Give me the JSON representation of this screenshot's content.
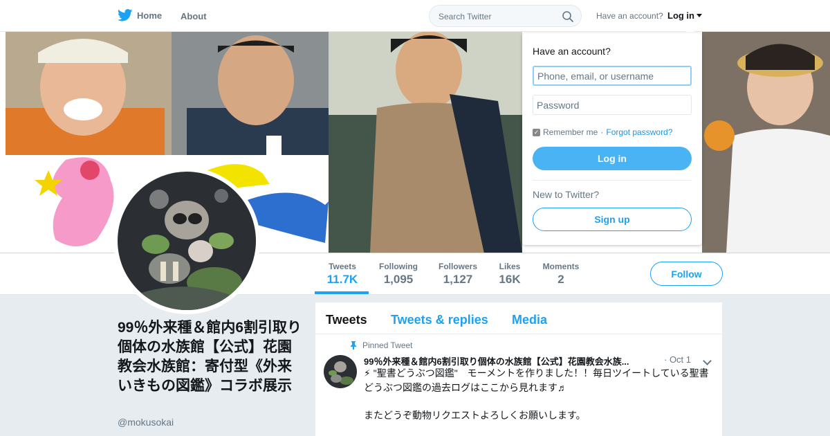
{
  "nav": {
    "home_label": "Home",
    "about_label": "About",
    "search_placeholder": "Search Twitter",
    "have_account": "Have an account?",
    "login_label": "Log in"
  },
  "profile": {
    "name": "99％外来種＆館内6割引取り個体の水族館【公式】花園教会水族館：寄付型《外来いきもの図鑑》コラボ展示",
    "handle": "@mokusokai",
    "follow_label": "Follow",
    "stats": [
      {
        "label": "Tweets",
        "value": "11.7K"
      },
      {
        "label": "Following",
        "value": "1,095"
      },
      {
        "label": "Followers",
        "value": "1,127"
      },
      {
        "label": "Likes",
        "value": "16K"
      },
      {
        "label": "Moments",
        "value": "2"
      }
    ]
  },
  "timeline": {
    "tabs": [
      "Tweets",
      "Tweets & replies",
      "Media"
    ],
    "pinned_label": "Pinned Tweet",
    "tweet": {
      "author": "99％外来種＆館内6割引取り個体の水族館【公式】花園教会水族...",
      "date": "· Oct 1",
      "text_line1": "⚡ \"聖書どうぶつ図鑑\"　モーメントを作りました！！毎日ツイートしている聖書どうぶつ図鑑の過去ログはここから見れます♬",
      "text_line2": "またどうぞ動物リクエストよろしくお願いします。"
    }
  },
  "login_dropdown": {
    "title": "Have an account?",
    "username_placeholder": "Phone, email, or username",
    "password_placeholder": "Password",
    "remember_label": "Remember me",
    "forgot_label": "Forgot password?",
    "login_button": "Log in",
    "new_label": "New to Twitter?",
    "signup_button": "Sign up"
  },
  "colors": {
    "accent": "#1da1f2",
    "login_button": "#4ab3f4",
    "background": "#e6ecf0"
  }
}
